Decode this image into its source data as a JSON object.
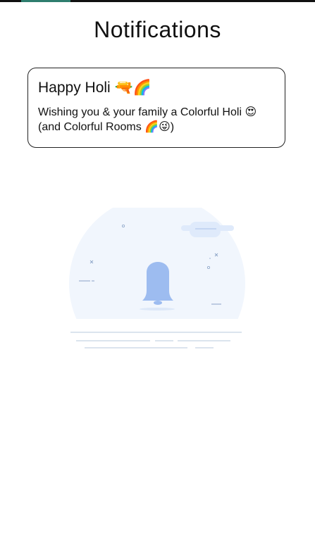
{
  "status_bar": {
    "accent_color": "#2e7d6e"
  },
  "header": {
    "title": "Notifications"
  },
  "notifications": [
    {
      "title": "Happy Holi 🔫🌈",
      "body": "Wishing you & your family a Colorful Holi 😍(and Colorful Rooms 🌈😜)"
    }
  ],
  "empty_state": {
    "icon": "bell-icon",
    "bell_color": "#9dbcf0",
    "circle_color": "#f1f6fd"
  }
}
